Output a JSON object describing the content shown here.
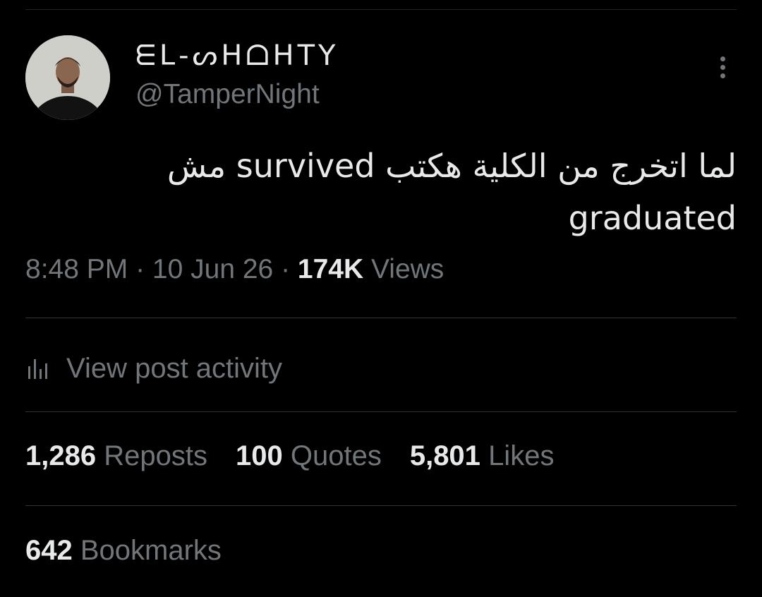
{
  "author": {
    "display_name": "ᗴᒪ-ᔕᕼᗝᕼTY",
    "handle": "@TamperNight"
  },
  "icons": {
    "more": "more-vertical-icon",
    "activity": "bar-chart-icon"
  },
  "tweet": {
    "text_line1": "لما اتخرج من الكلية هكتب survived مش",
    "text_line2": "graduated"
  },
  "meta": {
    "time": "8:48 PM",
    "sep1": " · ",
    "date": "10 Jun 26",
    "sep2": " · ",
    "views_count": "174K",
    "views_label": "Views"
  },
  "activity": {
    "label": "View post activity"
  },
  "stats": [
    {
      "count": "1,286",
      "label": "Reposts"
    },
    {
      "count": "100",
      "label": "Quotes"
    },
    {
      "count": "5,801",
      "label": "Likes"
    }
  ],
  "bookmarks": {
    "count": "642",
    "label": "Bookmarks"
  },
  "colors": {
    "background": "#000000",
    "primary_text": "#e7e9ea",
    "secondary_text": "#71767b",
    "divider": "#2f3336"
  }
}
